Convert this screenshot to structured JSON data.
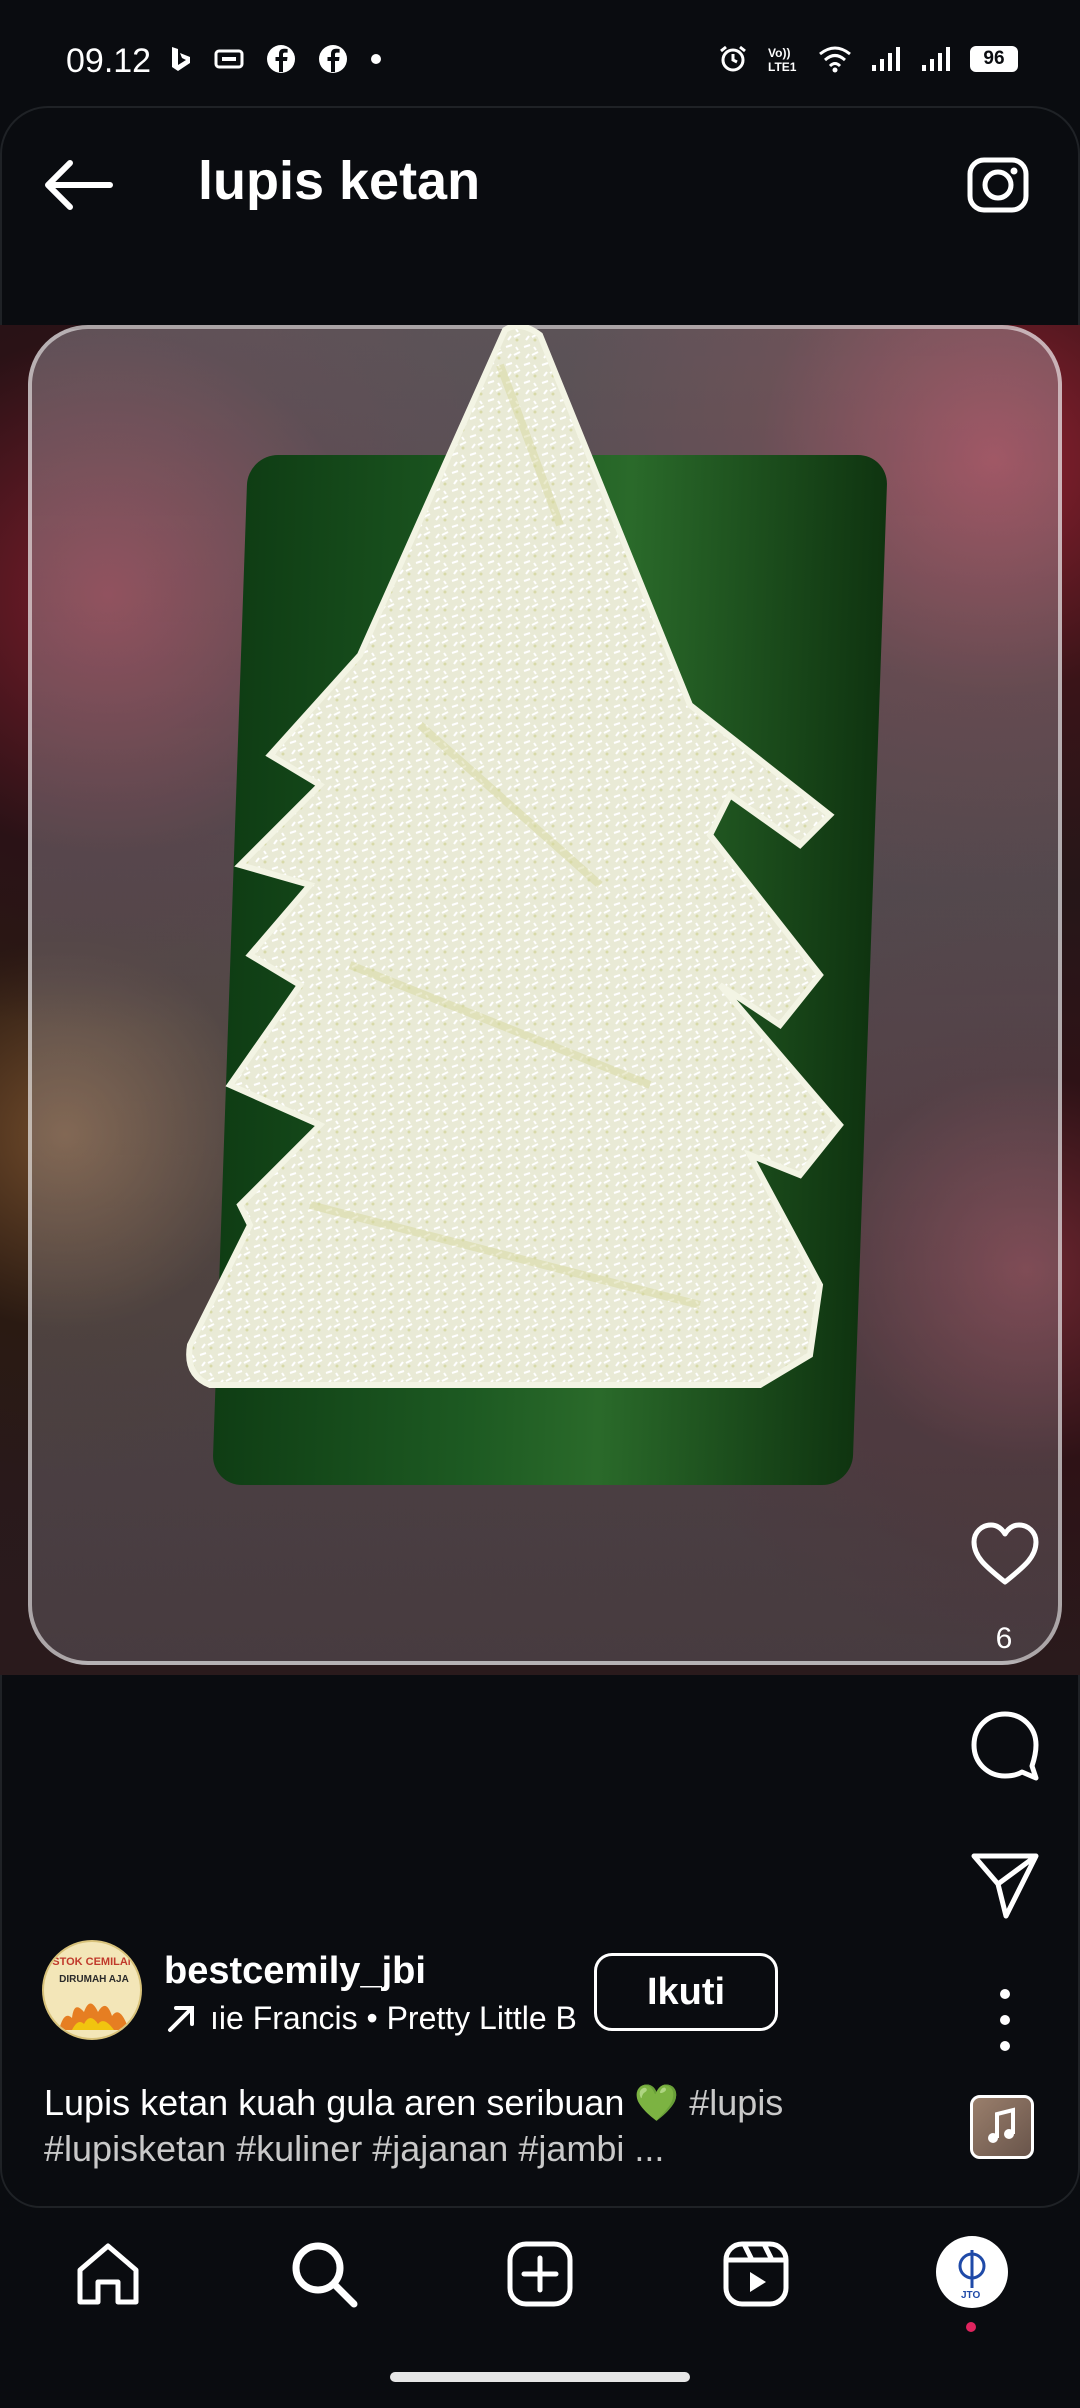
{
  "status_bar": {
    "time": "09.12",
    "battery": "96"
  },
  "header": {
    "title": "lupis ketan"
  },
  "post": {
    "like_count": "6",
    "author": {
      "username": "bestcemily_jbi",
      "avatar_line1": "STOK CEMILAN",
      "avatar_line2": "DIRUMAH AJA",
      "music": "ıie Francis • Pretty Little B"
    },
    "follow_label": "Ikuti",
    "caption_text": "Lupis ketan kuah gula aren seribuan 💚 ",
    "caption_tags_line1": "#lupis",
    "caption_tags_line2": "#lupisketan #kuliner #jajanan #jambi ..."
  },
  "colors": {
    "background": "#0a0c10",
    "notification_dot": "#e0245e",
    "leaf": "#1d5a22"
  }
}
